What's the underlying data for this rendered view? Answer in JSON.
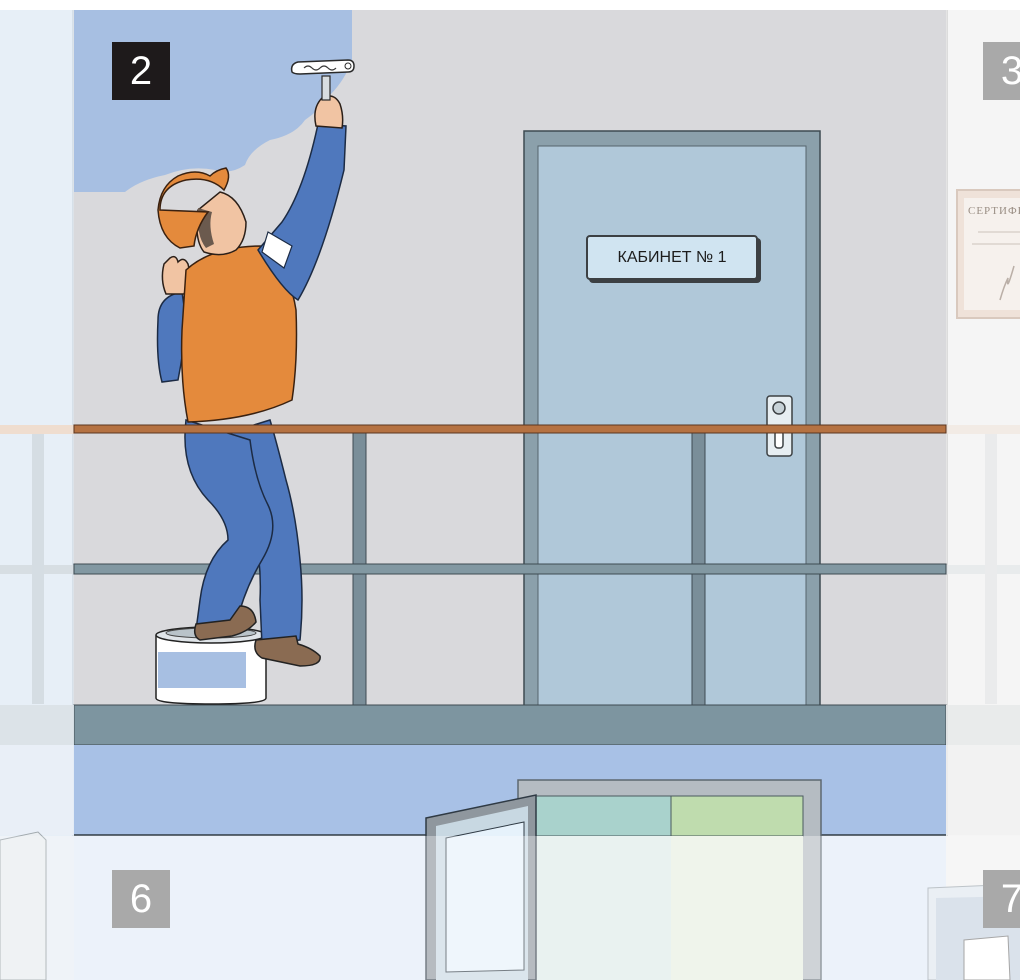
{
  "panels": {
    "active_number": "2",
    "right_top_number": "3",
    "left_bottom_number": "6",
    "right_bottom_number": "7"
  },
  "door": {
    "sign_text": "КАБИНЕТ № 1"
  },
  "certificate": {
    "visible_text": "СЕРТИФИ"
  },
  "colors": {
    "wall": "#d9d9dc",
    "painted_wall": "#a7bfe2",
    "door": "#b0c8d9",
    "railing_wood": "#b57242",
    "overalls": "#4f78bd",
    "vest": "#e48a3c",
    "floor_edge": "#7d95a0"
  }
}
